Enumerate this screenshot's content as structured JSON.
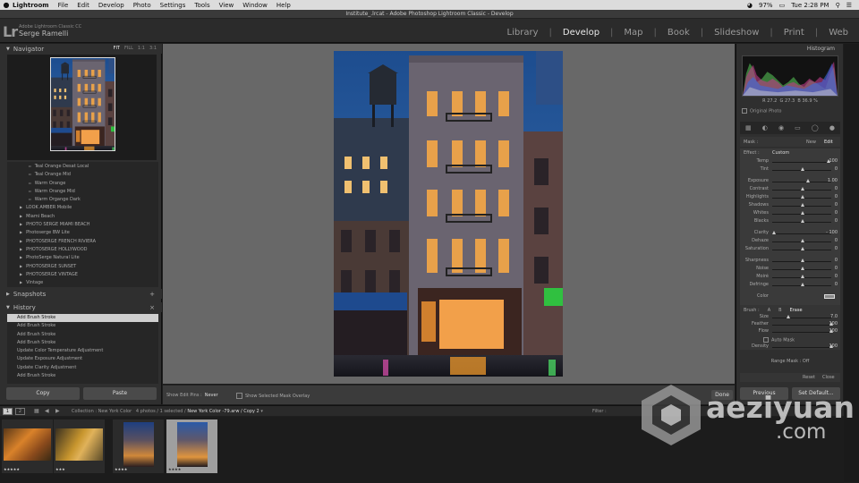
{
  "menubar": {
    "apple": "",
    "items": [
      "Lightroom",
      "File",
      "Edit",
      "Develop",
      "Photo",
      "Settings",
      "Tools",
      "View",
      "Window",
      "Help"
    ],
    "battery": "97%",
    "clock": "Tue 2:28 PM"
  },
  "window": {
    "title": "Institute_.lrcat - Adobe Photoshop Lightroom Classic - Develop"
  },
  "identity": {
    "logo": "Lr",
    "version": "Adobe Lightroom Classic CC",
    "user": "Serge Ramelli"
  },
  "modules": [
    "Library",
    "Develop",
    "Map",
    "Book",
    "Slideshow",
    "Print",
    "Web"
  ],
  "active_module": "Develop",
  "navigator": {
    "title": "Navigator",
    "zoom": [
      "FIT",
      "FILL",
      "1:1",
      "3:1"
    ]
  },
  "presets": [
    {
      "label": "Teal Orange Desat Local",
      "sub": true
    },
    {
      "label": "Teal Orange Mid",
      "sub": true
    },
    {
      "label": "Warm Orange",
      "sub": true
    },
    {
      "label": "Warm Orange Mid",
      "sub": true
    },
    {
      "label": "Warm Organge Dark",
      "sub": true
    },
    {
      "label": "LOOK AMBER Mobile",
      "sub": false
    },
    {
      "label": "Miami Beach",
      "sub": false
    },
    {
      "label": "PHOTO SERGE MIAMI BEACH",
      "sub": false
    },
    {
      "label": "Photoserge BW Lite",
      "sub": false
    },
    {
      "label": "PHOTOSERGE FRENCH RIVIERA",
      "sub": false
    },
    {
      "label": "PHOTOSERGE HOLLYWOOD",
      "sub": false
    },
    {
      "label": "PhotoSerge Natural Lite",
      "sub": false
    },
    {
      "label": "PHOTOSERGE SUNSET",
      "sub": false
    },
    {
      "label": "PHOTOSERGE VINTAGE",
      "sub": false
    },
    {
      "label": "Vintage",
      "sub": false
    }
  ],
  "snapshots": {
    "title": "Snapshots"
  },
  "history": {
    "title": "History",
    "items": [
      "Add Brush Stroke",
      "Add Brush Stroke",
      "Add Brush Stroke",
      "Add Brush Stroke",
      "Update Color Temperature Adjustment",
      "Update Exposure Adjustment",
      "Update Clarity Adjustment",
      "Add Brush Stroke"
    ]
  },
  "left_buttons": {
    "copy": "Copy",
    "paste": "Paste"
  },
  "toolbar": {
    "show_edit_pins": "Show Edit Pins :",
    "edit_pins_value": "Never",
    "show_mask_overlay": "Show Selected Mask Overlay",
    "done": "Done"
  },
  "histogram": {
    "title": "Histogram",
    "r": "R  27.2",
    "g": "G  27.3",
    "b": "B  36.9 %",
    "original_photo": "Original Photo"
  },
  "mask": {
    "label": "Mask :",
    "new": "New",
    "edit": "Edit"
  },
  "effect": {
    "label": "Effect :",
    "value": "Custom"
  },
  "sliders": [
    {
      "label": "Temp",
      "value": "100",
      "pos": 0.96
    },
    {
      "label": "Tint",
      "value": "0",
      "pos": 0.5
    },
    {
      "label": "Exposure",
      "value": "1.00",
      "pos": 0.6
    },
    {
      "label": "Contrast",
      "value": "0",
      "pos": 0.5
    },
    {
      "label": "Highlights",
      "value": "0",
      "pos": 0.5
    },
    {
      "label": "Shadows",
      "value": "0",
      "pos": 0.5
    },
    {
      "label": "Whites",
      "value": "0",
      "pos": 0.5
    },
    {
      "label": "Blacks",
      "value": "0",
      "pos": 0.5
    },
    {
      "label": "Clarity",
      "value": "- 100",
      "pos": 0.0
    },
    {
      "label": "Dehaze",
      "value": "0",
      "pos": 0.5
    },
    {
      "label": "Saturation",
      "value": "0",
      "pos": 0.5
    },
    {
      "label": "Sharpness",
      "value": "0",
      "pos": 0.5
    },
    {
      "label": "Noise",
      "value": "0",
      "pos": 0.5
    },
    {
      "label": "Moiré",
      "value": "0",
      "pos": 0.5
    },
    {
      "label": "Defringe",
      "value": "0",
      "pos": 0.5
    },
    {
      "label": "Color",
      "value": "",
      "pos": -1
    }
  ],
  "brush": {
    "label": "Brush :",
    "a": "A",
    "b": "B",
    "erase": "Erase",
    "size_label": "Size",
    "size": "7.0",
    "feather_label": "Feather",
    "feather": "100",
    "flow_label": "Flow",
    "flow": "100",
    "auto_mask": "Auto Mask",
    "density_label": "Density",
    "density": "100"
  },
  "range_mask": "Range Mask : Off",
  "reset": "Reset",
  "close": "Close",
  "right_buttons": {
    "previous": "Previous",
    "set_default": "Set Default..."
  },
  "filmhead": {
    "screen1": "1",
    "screen2": "2",
    "collection_prefix": "Collection : New York Color",
    "count": "4 photos / 1 selected /",
    "file": "New York Color -79.arw / Copy 2",
    "filter": "Filter :"
  },
  "filmstrip": [
    {
      "stars": "★★★★★",
      "kind": "autumn1"
    },
    {
      "stars": "★★★",
      "kind": "autumn2"
    },
    {
      "stars": "★★★★",
      "kind": "building1"
    },
    {
      "stars": "★★★★",
      "kind": "building2"
    }
  ],
  "watermark": {
    "line1": "aeziyuan",
    "line2": ".com"
  }
}
